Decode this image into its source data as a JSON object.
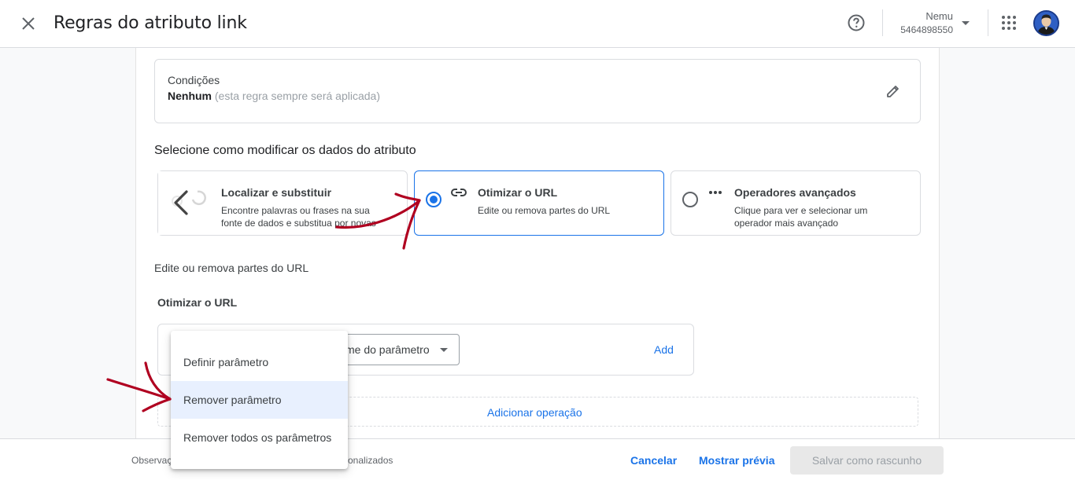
{
  "header": {
    "title": "Regras do atributo link",
    "account_name": "Nemu",
    "account_id": "5464898550",
    "icons": [
      "close-icon",
      "help-icon",
      "chevron-down-icon",
      "apps-grid-icon",
      "avatar"
    ]
  },
  "conditions": {
    "label": "Condições",
    "value": "Nenhum",
    "hint": "(esta regra sempre será aplicada)"
  },
  "modify_section": {
    "title": "Selecione como modificar os dados do atributo",
    "options": [
      {
        "title": "Localizar e substituir",
        "desc": "Encontre palavras ou frases na sua fonte de dados e substitua por novas",
        "selected": false
      },
      {
        "title": "Otimizar o URL",
        "desc": "Edite ou remova partes do URL",
        "selected": true
      },
      {
        "title": "Operadores avançados",
        "desc": "Clique para ver e selecionar um operador mais avançado",
        "selected": false
      }
    ]
  },
  "url_section": {
    "description": "Edite ou remova partes do URL",
    "subtitle": "Otimizar o URL",
    "param_select": "me do parâmetro",
    "add_label": "Add",
    "add_operation": "Adicionar operação"
  },
  "menu": {
    "items": [
      "Definir parâmetro",
      "Remover parâmetro",
      "Remover todos os parâmetros"
    ],
    "highlighted_index": 1
  },
  "footer": {
    "note_left": "Observaç",
    "note_right": "onalizados",
    "cancel": "Cancelar",
    "preview": "Mostrar prévia",
    "save": "Salvar como rascunho"
  },
  "colors": {
    "accent": "#1a73e8",
    "annotation": "#b00020",
    "menu_highlight": "#e8f0fe"
  }
}
